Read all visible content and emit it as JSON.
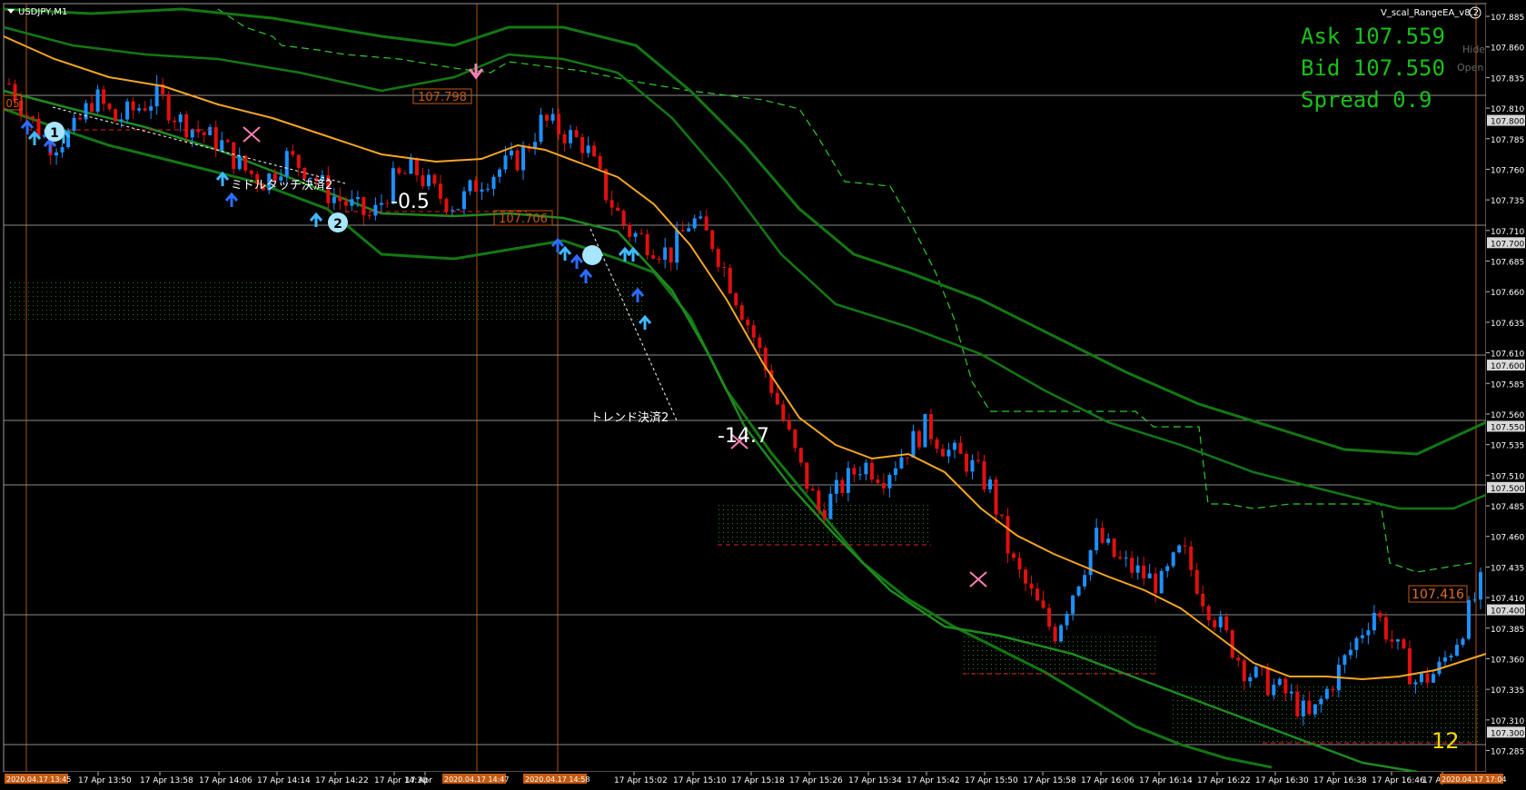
{
  "window": {
    "symbol_label": "USDJPY,M1",
    "ea_label": "V_scal_RangeEA_v8.2"
  },
  "quote": {
    "ask": "Ask 107.559",
    "bid": "Bid 107.550",
    "spread": "Spread 0.9",
    "hide_label": "Hide",
    "open_label": "Open",
    "color": "#19c019"
  },
  "annotations": {
    "middle_touch": "ミドルタッチ決済2",
    "trend": "トレンド決済2",
    "pnl_1": "-0.5",
    "pnl_2": "-14.7",
    "counter": "12",
    "marker_1": "1",
    "marker_2": "2",
    "left_clip": "05"
  },
  "level_labels": {
    "l1": "107.798",
    "l2": "107.706",
    "l3": "107.416"
  },
  "time_highlights": [
    "2020.04.17 13:45",
    "2020.04.17 14:47",
    "2020.04.17 14:58",
    "2020.04.17 17:04"
  ],
  "chart_data": {
    "type": "candlestick",
    "title": "USDJPY,M1",
    "ylim": [
      107.275,
      107.885
    ],
    "y_ticks": [
      "107.885",
      "107.860",
      "107.835",
      "107.810",
      "107.785",
      "107.760",
      "107.735",
      "107.710",
      "107.685",
      "107.660",
      "107.635",
      "107.610",
      "107.585",
      "107.560",
      "107.535",
      "107.510",
      "107.485",
      "107.460",
      "107.435",
      "107.410",
      "107.385",
      "107.360",
      "107.335",
      "107.310",
      "107.285"
    ],
    "highlighted_prices": [
      "107.800",
      "107.700",
      "107.600",
      "107.550",
      "107.500",
      "107.400",
      "107.300"
    ],
    "x_ticks": [
      "17 Apr 13:50",
      "17 Apr 13:58",
      "17 Apr 14:06",
      "17 Apr 14:14",
      "17 Apr 14:22",
      "17 Apr 14:30",
      "17 Apr",
      "17 Apr 15:02",
      "17 Apr 15:10",
      "17 Apr 15:18",
      "17 Apr 15:26",
      "17 Apr 15:34",
      "17 Apr 15:42",
      "17 Apr 15:50",
      "17 Apr 15:58",
      "17 Apr 16:06",
      "17 Apr 16:14",
      "17 Apr 16:22",
      "17 Apr 16:30",
      "17 Apr 16:38",
      "17 Apr 16:46",
      "17 Apr 16"
    ],
    "close_path": [
      107.83,
      107.8,
      107.78,
      107.79,
      107.82,
      107.8,
      107.81,
      107.82,
      107.8,
      107.79,
      107.78,
      107.76,
      107.75,
      107.77,
      107.76,
      107.74,
      107.73,
      107.72,
      107.75,
      107.76,
      107.74,
      107.73,
      107.75,
      107.76,
      107.77,
      107.8,
      107.79,
      107.78,
      107.74,
      107.71,
      107.7,
      107.69,
      107.72,
      107.7,
      107.66,
      107.62,
      107.57,
      107.52,
      107.48,
      107.5,
      107.52,
      107.51,
      107.53,
      107.55,
      107.53,
      107.52,
      107.5,
      107.44,
      107.41,
      107.38,
      107.42,
      107.46,
      107.44,
      107.43,
      107.42,
      107.45,
      107.41,
      107.38,
      107.35,
      107.34,
      107.33,
      107.31,
      107.34,
      107.37,
      107.4,
      107.37,
      107.34,
      107.35,
      107.38,
      107.42
    ],
    "series": [
      {
        "name": "ma",
        "color": "#f5a623"
      },
      {
        "name": "band-inner",
        "color": "#1f8a1f"
      },
      {
        "name": "band-outer",
        "color": "#137813"
      }
    ]
  }
}
